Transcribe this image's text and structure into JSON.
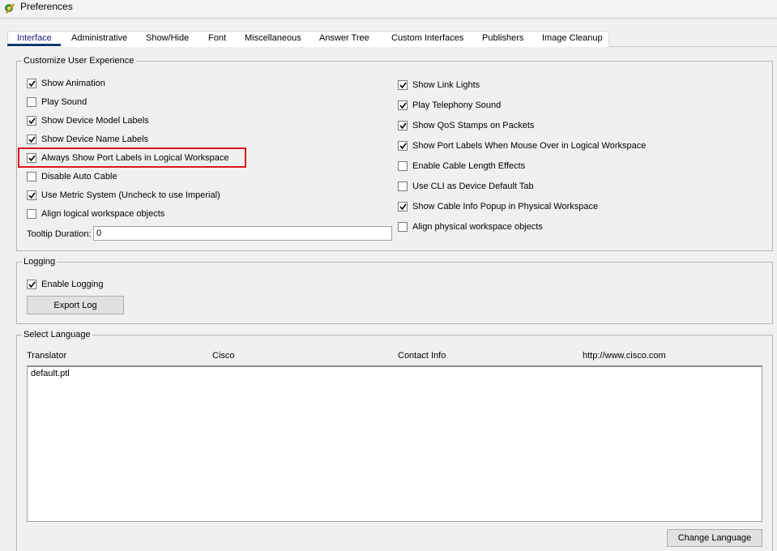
{
  "window": {
    "title": "Preferences"
  },
  "tabs": [
    {
      "label": "Interface",
      "active": true
    },
    {
      "label": "Administrative"
    },
    {
      "label": "Show/Hide"
    },
    {
      "label": "Font"
    },
    {
      "label": "Miscellaneous"
    },
    {
      "label": "Answer Tree"
    },
    {
      "label": "Custom Interfaces"
    },
    {
      "label": "Publishers"
    },
    {
      "label": "Image Cleanup"
    }
  ],
  "customize": {
    "legend": "Customize User Experience",
    "left_options": [
      {
        "label": "Show Animation",
        "checked": true
      },
      {
        "label": "Play Sound",
        "checked": false
      },
      {
        "label": "Show Device Model Labels",
        "checked": true
      },
      {
        "label": "Show Device Name Labels",
        "checked": true
      },
      {
        "label": "Always Show Port Labels in Logical Workspace",
        "checked": true
      },
      {
        "label": "Disable Auto Cable",
        "checked": false
      },
      {
        "label": "Use Metric System (Uncheck to use Imperial)",
        "checked": true
      },
      {
        "label": "Align logical workspace objects",
        "checked": false
      }
    ],
    "right_options": [
      {
        "label": "Show Link Lights",
        "checked": true
      },
      {
        "label": "Play Telephony Sound",
        "checked": true
      },
      {
        "label": "Show QoS Stamps on Packets",
        "checked": true
      },
      {
        "label": "Show Port Labels When Mouse Over in Logical Workspace",
        "checked": true
      },
      {
        "label": "Enable Cable Length Effects",
        "checked": false
      },
      {
        "label": "Use CLI as Device Default Tab",
        "checked": false
      },
      {
        "label": "Show Cable Info Popup in Physical Workspace",
        "checked": true
      },
      {
        "label": "Align physical workspace objects",
        "checked": false
      }
    ],
    "tooltip_label": "Tooltip Duration:",
    "tooltip_value": "0"
  },
  "logging": {
    "legend": "Logging",
    "enable_label": "Enable Logging",
    "enable_checked": true,
    "export_button": "Export Log"
  },
  "language": {
    "legend": "Select Language",
    "columns": [
      "Translator",
      "Cisco",
      "Contact Info",
      "http://www.cisco.com"
    ],
    "items": [
      "default.ptl"
    ],
    "change_button": "Change Language"
  },
  "colors": {
    "highlight": "#e0151c",
    "active_tab_underline": "#15376e"
  }
}
